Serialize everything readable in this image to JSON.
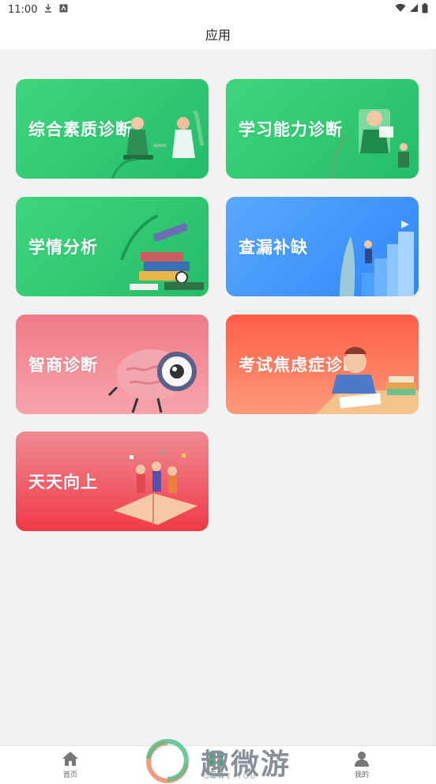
{
  "status_bar": {
    "time": "11:00"
  },
  "header": {
    "title": "应用"
  },
  "cards": [
    {
      "label": "综合素质诊断"
    },
    {
      "label": "学习能力诊断"
    },
    {
      "label": "学情分析"
    },
    {
      "label": "查漏补缺"
    },
    {
      "label": "智商诊断"
    },
    {
      "label": "考试焦虑症诊断"
    },
    {
      "label": "天天向上"
    }
  ],
  "bottom_nav": [
    {
      "label": "首页"
    },
    {
      "label": "应用"
    },
    {
      "label": "我的"
    }
  ],
  "watermark": {
    "text": "趣微游",
    "sub": "QUWEIYOU"
  },
  "colors": {
    "green": "#2ecb73",
    "blue": "#3a8ff8",
    "pink": "#f48d97",
    "orange": "#ff6e55",
    "red": "#f2505b",
    "active_nav": "#27b063"
  }
}
